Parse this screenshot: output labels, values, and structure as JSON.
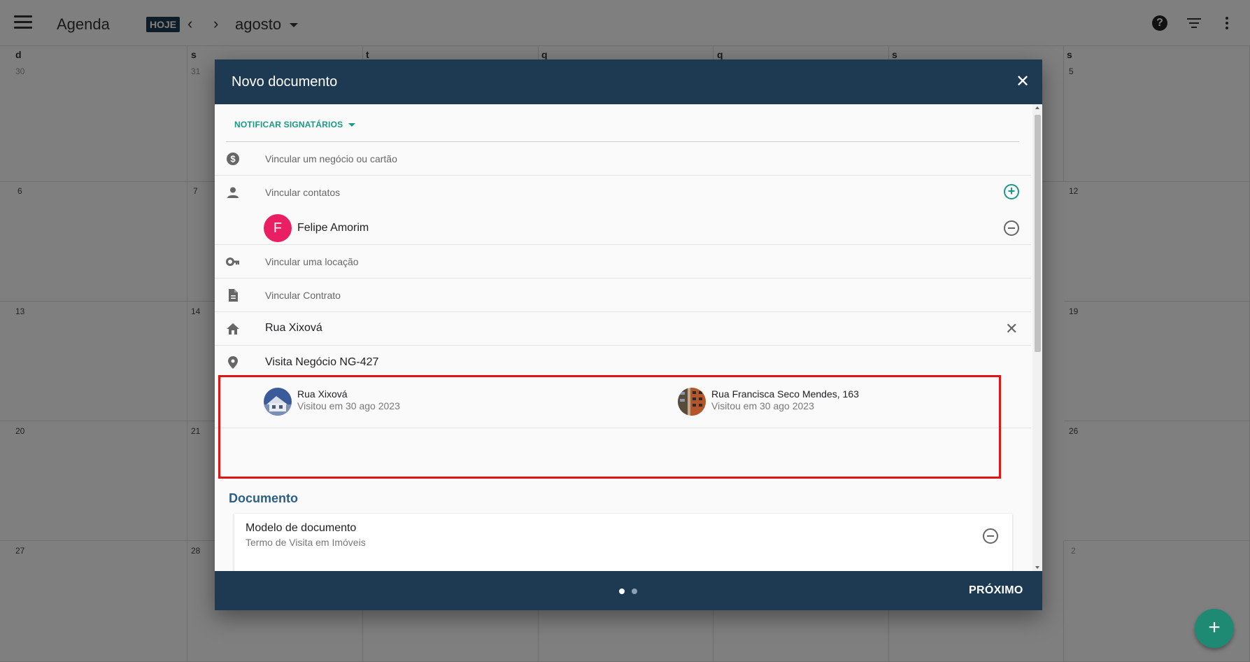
{
  "topbar": {
    "title": "Agenda",
    "today_label": "HOJE",
    "prev_arrow": "‹",
    "next_arrow": "›",
    "month": "agosto",
    "help_symbol": "?"
  },
  "calendar": {
    "weekdays": [
      "d",
      "s",
      "t",
      "q",
      "q",
      "s",
      "s"
    ],
    "weeks": [
      [
        "30",
        "31",
        "",
        "",
        "",
        "",
        "5"
      ],
      [
        "6",
        "7",
        "",
        "",
        "",
        "",
        "12"
      ],
      [
        "13",
        "14",
        "",
        "",
        "",
        "",
        "19"
      ],
      [
        "20",
        "21",
        "",
        "",
        "",
        "",
        "26"
      ],
      [
        "27",
        "28",
        "",
        "",
        "",
        "",
        "2"
      ]
    ]
  },
  "dialog": {
    "title": "Novo documento",
    "notify_label": "NOTIFICAR SIGNATÁRIOS",
    "link_deal_placeholder": "Vincular um negócio ou cartão",
    "link_contacts_placeholder": "Vincular contatos",
    "contact": {
      "initial": "F",
      "name": "Felipe Amorim"
    },
    "link_rental_placeholder": "Vincular uma locação",
    "link_contract_placeholder": "Vincular Contrato",
    "property": "Rua Xixová",
    "visit": {
      "title": "Visita Negócio NG-427",
      "items": [
        {
          "name": "Rua Xixová",
          "date": "Visitou em 30 ago 2023"
        },
        {
          "name": "Rua Francisca Seco Mendes, 163",
          "date": "Visitou em 30 ago 2023"
        }
      ]
    },
    "document_section": "Documento",
    "document_model": {
      "title": "Modelo de documento",
      "value": "Termo de Visita em Imóveis"
    },
    "next_label": "PRÓXIMO",
    "close_symbol": "✕"
  },
  "fab_symbol": "+",
  "colors": {
    "header": "#1e3a52",
    "accent": "#1a9a83",
    "avatar": "#e91e63",
    "highlight": "#e11414",
    "section_title": "#2c5f86"
  }
}
